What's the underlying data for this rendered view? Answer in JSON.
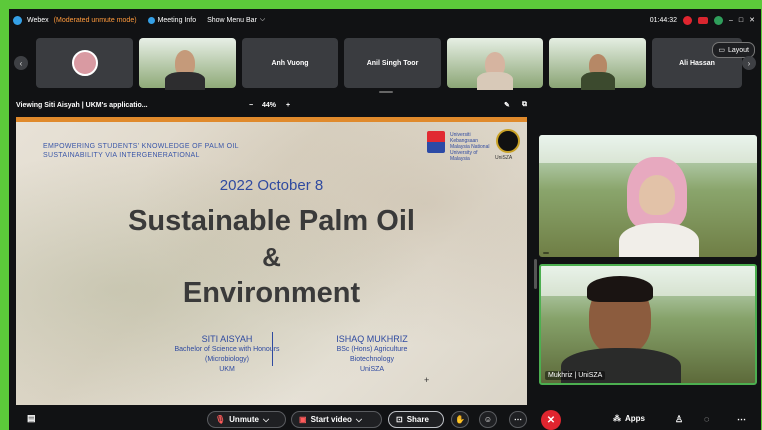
{
  "titlebar": {
    "app_name": "Webex",
    "status": "(Moderated unmute mode)",
    "meeting_info": "Meeting Info",
    "show_menu_bar": "Show Menu Bar",
    "timer": "01:44:32"
  },
  "participants": {
    "tiles": [
      {
        "label": ""
      },
      {
        "label": ""
      },
      {
        "label": "Anh Vuong"
      },
      {
        "label": "Anil Singh Toor"
      },
      {
        "label": ""
      },
      {
        "label": ""
      },
      {
        "label": "Ali Hassan"
      }
    ],
    "layout_button": "Layout"
  },
  "share_view": {
    "viewing_label": "Viewing Siti Aisyah | UKM's applicatio...",
    "zoom_minus": "−",
    "zoom_level": "44%",
    "zoom_plus": "+"
  },
  "slide": {
    "tagline_line1": "EMPOWERING STUDENTS' KNOWLEDGE OF PALM OIL",
    "tagline_line2": "SUSTAINABILITY VIA INTERGENERATIONAL",
    "date": "2022 October 8",
    "title_line1": "Sustainable Palm Oil",
    "title_line2": "&",
    "title_line3": "Environment",
    "left_name": "SITI AISYAH",
    "left_line1": "Bachelor of Science with Honours",
    "left_line2": "(Microbiology)",
    "left_line3": "UKM",
    "right_name": "ISHAQ MUKHRIZ",
    "right_line1": "BSc (Hons) Agriculture",
    "right_line2": "Biotechnology",
    "right_line3": "UniSZA",
    "ukm_text": "Universiti Kebangsaan Malaysia National University of Malaysia",
    "unisza_text": "UniSZA"
  },
  "videos": {
    "top_name": "",
    "bottom_name": "Mukhriz | UniSZA"
  },
  "toolbar": {
    "unmute": "Unmute",
    "start_video": "Start video",
    "share": "Share",
    "apps": "Apps"
  },
  "colors": {
    "accent_green": "#5cc93a",
    "leave_red": "#e0252f",
    "slide_blue": "#2f4aa0"
  }
}
